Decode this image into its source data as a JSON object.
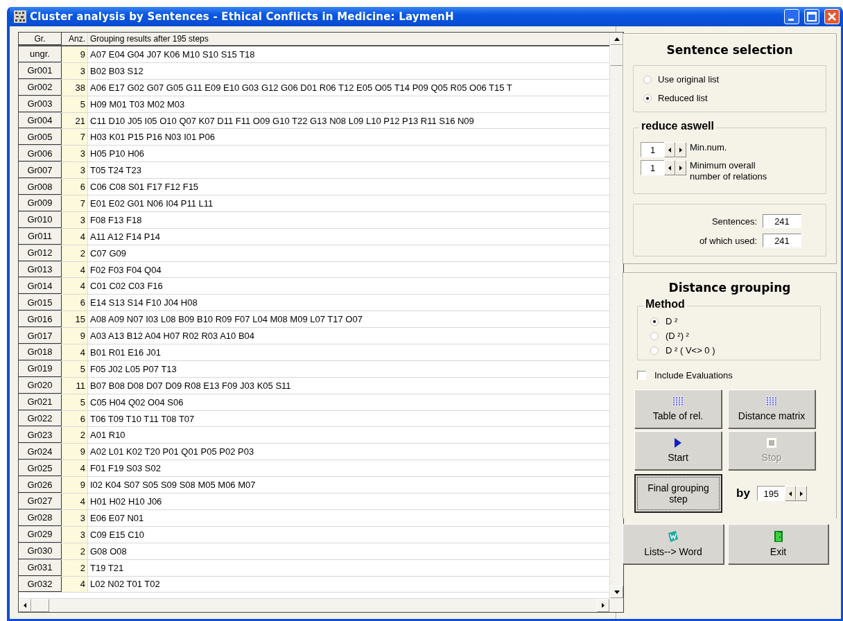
{
  "window": {
    "title": "Cluster analysis by Sentences - Ethical Conflicts in Medicine: LaymenH"
  },
  "table": {
    "columns": [
      "Gr.",
      "Anz.",
      "Grouping results after 195 steps"
    ],
    "rows": [
      {
        "group": "ungr.",
        "count": "9",
        "members": "A07 E04 G04 J07 K06 M10 S10 S15 T18"
      },
      {
        "group": "Gr001",
        "count": "3",
        "members": "B02 B03 S12"
      },
      {
        "group": "Gr002",
        "count": "38",
        "members": "A06 E17 G02 G07 G05 G11 E09 E10 G03 G12 G06 D01 R06 T12 E05 O05 T14 P09 Q05 R05 O06 T15 T"
      },
      {
        "group": "Gr003",
        "count": "5",
        "members": "H09 M01 T03 M02 M03"
      },
      {
        "group": "Gr004",
        "count": "21",
        "members": "C11 D10 J05 I05 O10 Q07 K07 D11 F11 O09 G10 T22 G13 N08 L09 L10 P12 P13 R11 S16 N09"
      },
      {
        "group": "Gr005",
        "count": "7",
        "members": "H03 K01 P15 P16 N03 I01 P06"
      },
      {
        "group": "Gr006",
        "count": "3",
        "members": "H05 P10 H06"
      },
      {
        "group": "Gr007",
        "count": "3",
        "members": "T05 T24 T23"
      },
      {
        "group": "Gr008",
        "count": "6",
        "members": "C06 C08 S01 F17 F12 F15"
      },
      {
        "group": "Gr009",
        "count": "7",
        "members": "E01 E02 G01 N06 I04 P11 L11"
      },
      {
        "group": "Gr010",
        "count": "3",
        "members": "F08 F13 F18"
      },
      {
        "group": "Gr011",
        "count": "4",
        "members": "A11 A12 F14 P14"
      },
      {
        "group": "Gr012",
        "count": "2",
        "members": "C07 G09"
      },
      {
        "group": "Gr013",
        "count": "4",
        "members": "F02 F03 F04 Q04"
      },
      {
        "group": "Gr014",
        "count": "4",
        "members": "C01 C02 C03 F16"
      },
      {
        "group": "Gr015",
        "count": "6",
        "members": "E14 S13 S14 F10 J04 H08"
      },
      {
        "group": "Gr016",
        "count": "15",
        "members": "A08 A09 N07 I03 L08 B09 B10 R09 F07 L04 M08 M09 L07 T17 O07"
      },
      {
        "group": "Gr017",
        "count": "9",
        "members": "A03 A13 B12 A04 H07 R02 R03 A10 B04"
      },
      {
        "group": "Gr018",
        "count": "4",
        "members": "B01 R01 E16 J01"
      },
      {
        "group": "Gr019",
        "count": "5",
        "members": "F05 J02 L05 P07 T13"
      },
      {
        "group": "Gr020",
        "count": "11",
        "members": "B07 B08 D08 D07 D09 R08 E13 F09 J03 K05 S11"
      },
      {
        "group": "Gr021",
        "count": "5",
        "members": "C05 H04 Q02 O04 S06"
      },
      {
        "group": "Gr022",
        "count": "6",
        "members": "T06 T09 T10 T11 T08 T07"
      },
      {
        "group": "Gr023",
        "count": "2",
        "members": "A01 R10"
      },
      {
        "group": "Gr024",
        "count": "9",
        "members": "A02 L01 K02 T20 P01 Q01 P05 P02 P03"
      },
      {
        "group": "Gr025",
        "count": "4",
        "members": "F01 F19 S03 S02"
      },
      {
        "group": "Gr026",
        "count": "9",
        "members": "I02 K04 S07 S05 S09 S08 M05 M06 M07"
      },
      {
        "group": "Gr027",
        "count": "4",
        "members": "H01 H02 H10 J06"
      },
      {
        "group": "Gr028",
        "count": "3",
        "members": "E06 E07 N01"
      },
      {
        "group": "Gr029",
        "count": "3",
        "members": "C09 E15 C10"
      },
      {
        "group": "Gr030",
        "count": "2",
        "members": "G08 O08"
      },
      {
        "group": "Gr031",
        "count": "2",
        "members": "T19 T21"
      },
      {
        "group": "Gr032",
        "count": "4",
        "members": "L02 N02 T01 T02"
      }
    ]
  },
  "sentence_selection": {
    "title": "Sentence selection",
    "options": [
      {
        "label": "Use original list",
        "selected": false
      },
      {
        "label": "Reduced list",
        "selected": true
      }
    ],
    "reduce": {
      "title": "reduce aswell",
      "spinners": [
        {
          "value": "1",
          "label": "Min.num."
        },
        {
          "value": "1",
          "label": "Minimum overall number of relations"
        }
      ]
    },
    "counts": [
      {
        "label": "Sentences:",
        "value": "241"
      },
      {
        "label": "of which used:",
        "value": "241"
      }
    ]
  },
  "distance_grouping": {
    "title": "Distance grouping",
    "method": {
      "title": "Method",
      "options": [
        {
          "label": "D ²",
          "selected": true
        },
        {
          "label": "(D ²) ²",
          "selected": false
        },
        {
          "label": "D ² ( V<> 0 )",
          "selected": false
        }
      ]
    },
    "include_evaluations": {
      "label": "Include Evaluations",
      "checked": false
    },
    "buttons": [
      {
        "label": "Table of rel.",
        "kind": "grid",
        "disabled": false
      },
      {
        "label": "Distance matrix",
        "kind": "grid",
        "disabled": false
      },
      {
        "label": "Start",
        "kind": "play",
        "disabled": false
      },
      {
        "label": "Stop",
        "kind": "stop",
        "disabled": true
      }
    ],
    "final_step": {
      "button": "Final grouping step",
      "by": "by",
      "value": "195"
    }
  },
  "bottom_buttons": [
    {
      "label": "Lists--> Word",
      "kind": "word",
      "disabled": false
    },
    {
      "label": "Exit",
      "kind": "door",
      "disabled": false
    }
  ]
}
